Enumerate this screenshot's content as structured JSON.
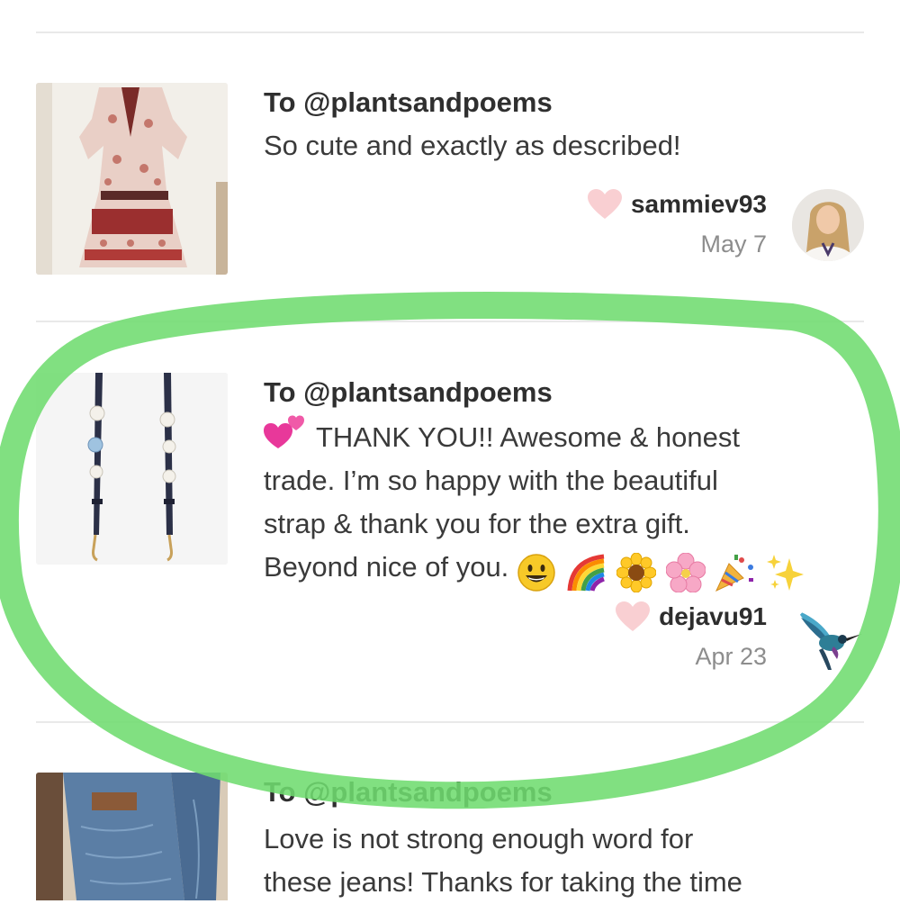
{
  "reviews": [
    {
      "to": "To @plantsandpoems",
      "text": "So cute and exactly as described!",
      "username": "sammiev93",
      "date": "May 7",
      "item_image": "dress-photo",
      "avatar_image": "user-photo-icon"
    },
    {
      "to": "To @plantsandpoems",
      "text_line1": "THANK YOU!! Awesome & honest",
      "text_line2": "trade. I’m so happy with the beautiful",
      "text_line3": "strap & thank you for the extra gift.",
      "text_line4": "Beyond nice of you.",
      "lead_emoji": "two-hearts-icon",
      "trail_emojis": [
        "smiley-icon",
        "rainbow-icon",
        "sunflower-icon",
        "cherry-blossom-icon",
        "party-popper-icon",
        "sparkles-icon"
      ],
      "username": "dejavu91",
      "date": "Apr 23",
      "item_image": "floral-strap-photo",
      "avatar_image": "hummingbird-icon"
    },
    {
      "to": "To @plantsandpoems",
      "text_line1": "Love is not strong enough word for",
      "text_line2": "these jeans! Thanks for taking the time",
      "item_image": "jeans-photo"
    }
  ],
  "colors": {
    "heart": "#f9cfd2",
    "highlight_ring": "#6fdc6f",
    "divider": "#e9e9e9",
    "date_text": "#8d8d8d"
  }
}
